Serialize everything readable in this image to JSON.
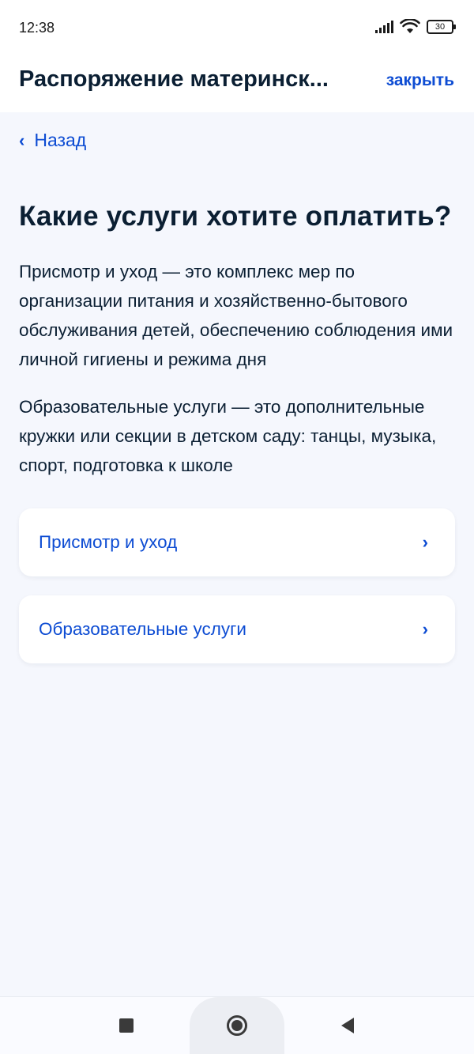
{
  "status_bar": {
    "time": "12:38",
    "battery_level": "30",
    "icons": [
      "signal-icon",
      "wifi-icon",
      "battery-icon"
    ]
  },
  "header": {
    "title": "Распоряжение материнск...",
    "close_label": "закрыть"
  },
  "back": {
    "label": "Назад",
    "icon": "chevron-left-icon"
  },
  "main": {
    "question": "Какие услуги хотите оплатить?",
    "paragraphs": [
      "Присмотр и уход — это комплекс мер по организации питания и хозяйственно-бытового обслуживания детей, обеспечению соблюдения ими личной гигиены и режима дня",
      "Образовательные услуги — это дополнительные кружки или секции в детском саду: танцы, музыка, спорт, подготовка к школе"
    ],
    "options": [
      {
        "label": "Присмотр и уход",
        "icon": "chevron-right-icon"
      },
      {
        "label": "Образовательные услуги",
        "icon": "chevron-right-icon"
      }
    ]
  },
  "nav_bar": {
    "icons": [
      "recent-apps-icon",
      "home-icon",
      "back-triangle-icon"
    ]
  },
  "colors": {
    "accent": "#0d4cd3",
    "text": "#0b1f33",
    "background": "#f5f7fd",
    "card": "#ffffff"
  }
}
